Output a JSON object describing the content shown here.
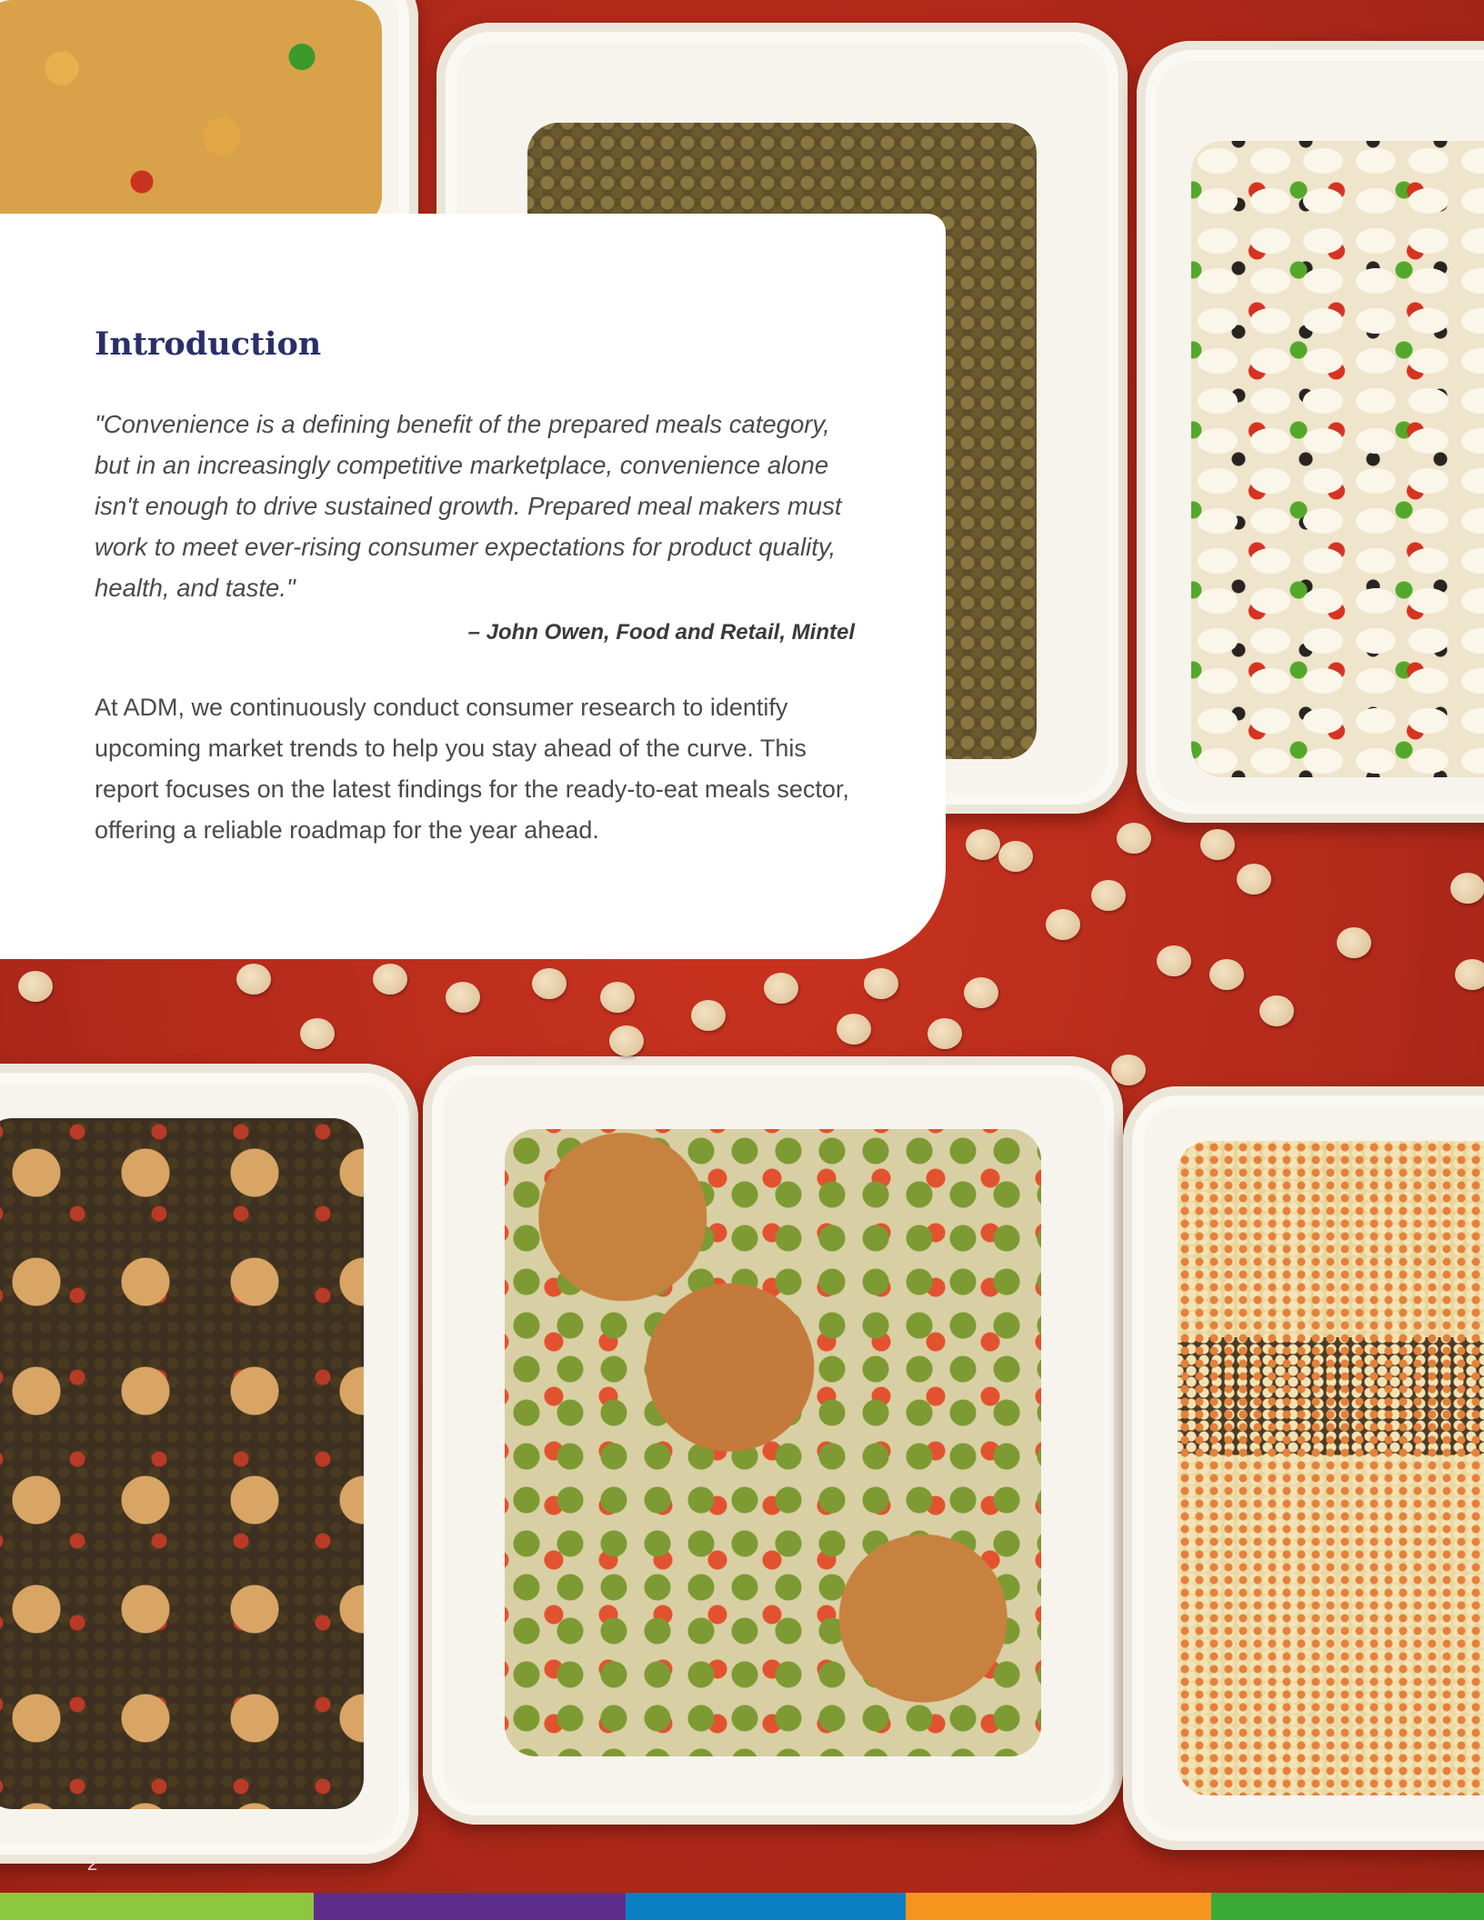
{
  "intro": {
    "title": "Introduction",
    "quote": "\"Convenience is a defining benefit of the prepared meals category, but in an increasingly competitive marketplace, convenience alone isn't enough to drive sustained growth. Prepared meal makers must work to meet ever-rising consumer expectations for product quality, health, and taste.\"",
    "attribution": "–  John Owen, Food and Retail, Mintel",
    "body": "At ADM, we continuously conduct consumer research to identify upcoming market trends to help you stay ahead of the curve. This report focuses on the latest findings for the ready-to-eat meals sector, offering a reliable roadmap for the year ahead."
  },
  "footer": {
    "page_number": "2",
    "band_colors": [
      "#8dc63f",
      "#5d2e8c",
      "#0a7fc2",
      "#f7941d",
      "#3aa935"
    ]
  },
  "photo": {
    "description_icon": "prepared-meal-trays-photo"
  }
}
